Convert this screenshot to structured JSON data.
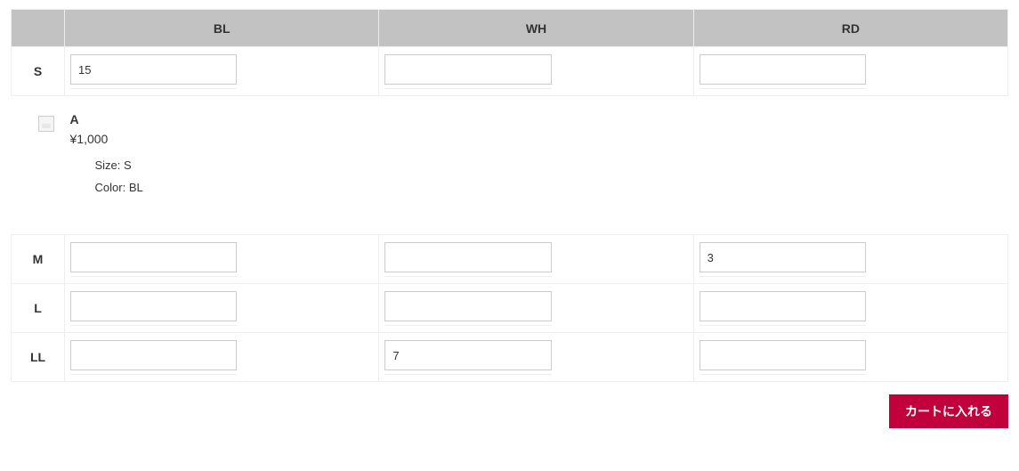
{
  "table": {
    "columns": [
      "BL",
      "WH",
      "RD"
    ],
    "rows": [
      {
        "label": "S",
        "values": [
          "15",
          "",
          ""
        ]
      },
      {
        "label": "M",
        "values": [
          "",
          "",
          "3"
        ]
      },
      {
        "label": "L",
        "values": [
          "",
          "",
          ""
        ]
      },
      {
        "label": "LL",
        "values": [
          "",
          "7",
          ""
        ]
      }
    ]
  },
  "detail": {
    "product_name": "A",
    "price_display": "¥1,000",
    "size_label": "Size:",
    "size_value": "S",
    "color_label": "Color:",
    "color_value": "BL"
  },
  "cart_button_label": "カートに入れる"
}
